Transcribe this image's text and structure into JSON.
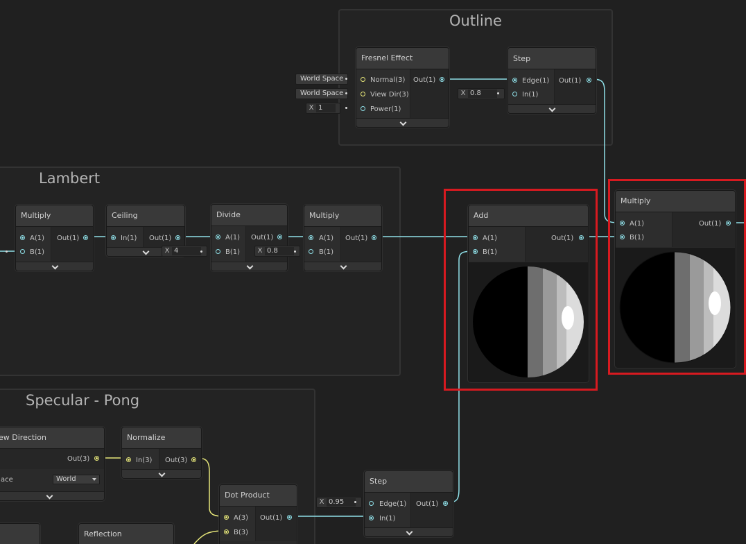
{
  "groups": {
    "outline": "Outline",
    "lambert": "Lambert",
    "specular": "Specular - Pong"
  },
  "nodes": {
    "fresnel": {
      "title": "Fresnel Effect",
      "in1": "Normal(3)",
      "in2": "View Dir(3)",
      "in3": "Power(1)",
      "out": "Out(1)",
      "in1_value": "World Space",
      "in2_value": "World Space",
      "in3_label": "X",
      "in3_value": "1"
    },
    "step_outline": {
      "title": "Step",
      "in1": "Edge(1)",
      "in2": "In(1)",
      "out": "Out(1)",
      "edge_label": "X",
      "edge_value": "0.8"
    },
    "multiply1": {
      "title": "Multiply",
      "in1": "A(1)",
      "in2": "B(1)",
      "out": "Out(1)"
    },
    "ceiling": {
      "title": "Ceiling",
      "in1": "In(1)",
      "out": "Out(1)"
    },
    "divide": {
      "title": "Divide",
      "in1": "A(1)",
      "in2": "B(1)",
      "out": "Out(1)",
      "b_label": "X",
      "b_value": "4"
    },
    "multiply2": {
      "title": "Multiply",
      "in1": "A(1)",
      "in2": "B(1)",
      "out": "Out(1)",
      "b_label": "X",
      "b_value": "0.8"
    },
    "add": {
      "title": "Add",
      "in1": "A(1)",
      "in2": "B(1)",
      "out": "Out(1)"
    },
    "multiply3": {
      "title": "Multiply",
      "in1": "A(1)",
      "in2": "B(1)",
      "out": "Out(1)"
    },
    "view_direction": {
      "title": "ew Direction",
      "out": "Out(3)",
      "space_label": "ace",
      "space_value": "World"
    },
    "normalize": {
      "title": "Normalize",
      "in1": "In(3)",
      "out": "Out(3)"
    },
    "dot_product": {
      "title": "Dot Product",
      "in1": "A(3)",
      "in2": "B(3)",
      "out": "Out(1)"
    },
    "step_spec": {
      "title": "Step",
      "in1": "Edge(1)",
      "in2": "In(1)",
      "out": "Out(1)",
      "edge_label": "X",
      "edge_value": "0.95"
    },
    "reflection": {
      "title": "Reflection"
    }
  },
  "colors": {
    "wire_float": "#8fe0e8",
    "wire_vector": "#e8e87a",
    "highlight": "#d71a20"
  }
}
